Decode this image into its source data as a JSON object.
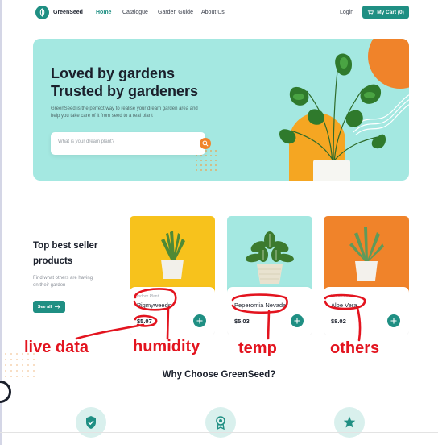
{
  "nav": {
    "brand": "GreenSeed",
    "links": [
      "Home",
      "Catalogue",
      "Garden Guide",
      "About Us"
    ],
    "login": "Login",
    "cart": "My Cart (0)"
  },
  "hero": {
    "title_line1": "Loved by gardens",
    "title_line2": "Trusted by gardeners",
    "subtitle": "GreenSeed is the perfect way to realise your dream garden area and help you take care of it from seed to a real plant",
    "search_placeholder": "What is your dream plant?"
  },
  "best_sellers": {
    "title_line1": "Top best seller",
    "title_line2": "products",
    "subtitle": "Find what others are having on their garden",
    "see_all": "See all",
    "products": [
      {
        "category": "Indoor Plant",
        "name": "Pigmyweeds",
        "price": "$5.07",
        "bg": "#f7c21c"
      },
      {
        "category": "",
        "name": "Peperomia Nevada",
        "price": "$5.03",
        "bg": "#a4e8e1"
      },
      {
        "category": "Indoor Plant",
        "name": "Aloe Vera",
        "price": "$8.02",
        "bg": "#f0832a"
      }
    ]
  },
  "annotations": {
    "live_data": "live data",
    "humidity": "humidity",
    "temp": "temp",
    "others": "others"
  },
  "why": {
    "title": "Why Choose GreenSeed?",
    "features": [
      "shield-check-icon",
      "award-ribbon-icon",
      "star-icon"
    ]
  },
  "colors": {
    "brand": "#1f8f83",
    "hero_bg": "#a4e8e1",
    "accent": "#f0832a",
    "annotation": "#e3141f"
  }
}
